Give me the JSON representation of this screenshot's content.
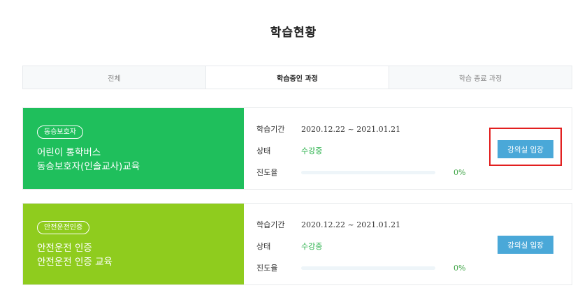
{
  "page": {
    "title": "학습현황"
  },
  "tabs": [
    {
      "label": "전체",
      "active": false
    },
    {
      "label": "학습중인 과정",
      "active": true
    },
    {
      "label": "학습 종료 과정",
      "active": false
    }
  ],
  "courses": [
    {
      "badge": "동승보호자",
      "title_line1": "어린이 통학버스",
      "title_line2": "동승보호자(인솔교사)교육",
      "color": "#1fbf5c",
      "period_label": "학습기간",
      "period": "2020.12.22 ~ 2021.01.21",
      "status_label": "상태",
      "status": "수강중",
      "progress_label": "진도율",
      "progress_percent": 0,
      "progress_text": "0%",
      "button": "강의실 입장"
    },
    {
      "badge": "안전운전인증",
      "title_line1": "안전운전 인증",
      "title_line2": "안전운전 인증 교육",
      "color": "#8fcc1e",
      "period_label": "학습기간",
      "period": "2020.12.22 ~ 2021.01.21",
      "status_label": "상태",
      "status": "수강중",
      "progress_label": "진도율",
      "progress_percent": 0,
      "progress_text": "0%",
      "button": "강의실 입장"
    }
  ],
  "colors": {
    "accent_button": "#4aa8d8",
    "status_green": "#2bb24c",
    "highlight": "#e21f1f"
  }
}
